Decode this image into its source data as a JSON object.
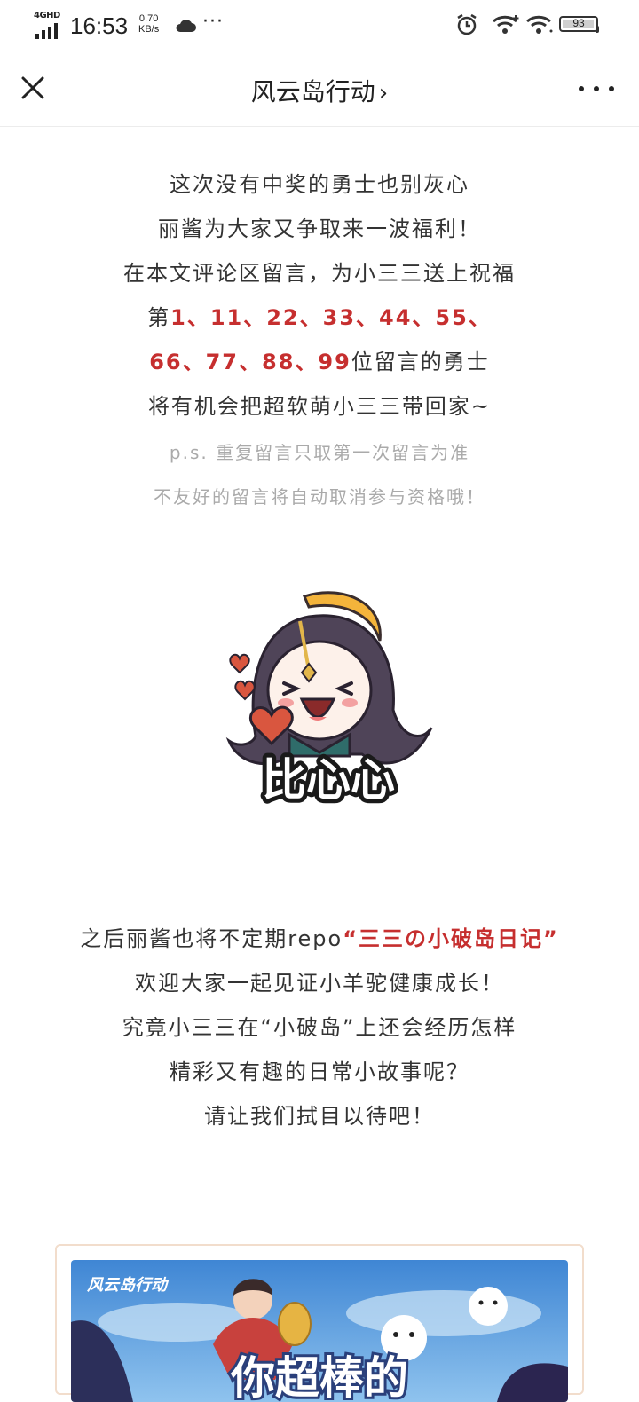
{
  "status_bar": {
    "network_type": "4GHD",
    "time": "16:53",
    "speed_value": "0.70",
    "speed_unit": "KB/s",
    "more_indicator": "···",
    "battery_level": "93"
  },
  "navbar": {
    "title": "风云岛行动",
    "chevron": "›"
  },
  "article": {
    "line1": "这次没有中奖的勇士也别灰心",
    "line2": "丽酱为大家又争取来一波福利！",
    "line3": "在本文评论区留言，为小三三送上祝福",
    "line4_prefix": "第",
    "line4_numbers": "1、11、22、33、44、55、",
    "line5_numbers": "66、77、88、99",
    "line5_suffix": "位留言的勇士",
    "line6": "将有机会把超软萌小三三带回家~",
    "note1": "p.s. 重复留言只取第一次留言为准",
    "note2": "不友好的留言将自动取消参与资格哦！",
    "sticker_caption": "比心心",
    "line7_prefix": "之后丽酱也将不定期repo",
    "line7_highlight": "“三三の小破岛日记”",
    "line8": "欢迎大家一起见证小羊驼健康成长！",
    "line9": "究竟小三三在“小破岛”上还会经历怎样",
    "line10": "精彩又有趣的日常小故事呢？",
    "line11": "请让我们拭目以待吧！"
  },
  "banner": {
    "logo_text": "风云岛行动",
    "headline": "你超棒的"
  },
  "colors": {
    "highlight_red": "#c62f2f",
    "note_gray": "#aaaaaa",
    "body_text": "#333333"
  }
}
